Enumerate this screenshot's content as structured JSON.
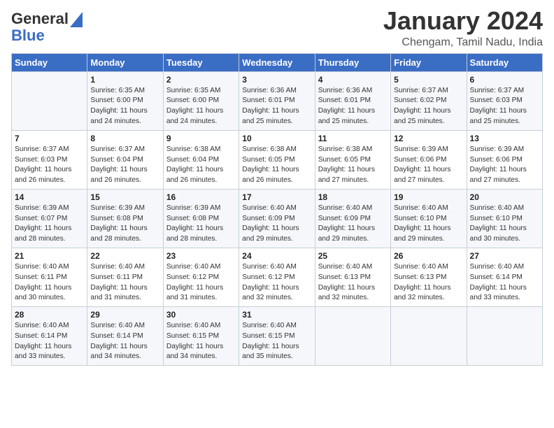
{
  "logo": {
    "line1": "General",
    "line2": "Blue"
  },
  "title": "January 2024",
  "location": "Chengam, Tamil Nadu, India",
  "days_of_week": [
    "Sunday",
    "Monday",
    "Tuesday",
    "Wednesday",
    "Thursday",
    "Friday",
    "Saturday"
  ],
  "weeks": [
    [
      {
        "day": "",
        "info": ""
      },
      {
        "day": "1",
        "info": "Sunrise: 6:35 AM\nSunset: 6:00 PM\nDaylight: 11 hours\nand 24 minutes."
      },
      {
        "day": "2",
        "info": "Sunrise: 6:35 AM\nSunset: 6:00 PM\nDaylight: 11 hours\nand 24 minutes."
      },
      {
        "day": "3",
        "info": "Sunrise: 6:36 AM\nSunset: 6:01 PM\nDaylight: 11 hours\nand 25 minutes."
      },
      {
        "day": "4",
        "info": "Sunrise: 6:36 AM\nSunset: 6:01 PM\nDaylight: 11 hours\nand 25 minutes."
      },
      {
        "day": "5",
        "info": "Sunrise: 6:37 AM\nSunset: 6:02 PM\nDaylight: 11 hours\nand 25 minutes."
      },
      {
        "day": "6",
        "info": "Sunrise: 6:37 AM\nSunset: 6:03 PM\nDaylight: 11 hours\nand 25 minutes."
      }
    ],
    [
      {
        "day": "7",
        "info": "Sunrise: 6:37 AM\nSunset: 6:03 PM\nDaylight: 11 hours\nand 26 minutes."
      },
      {
        "day": "8",
        "info": "Sunrise: 6:37 AM\nSunset: 6:04 PM\nDaylight: 11 hours\nand 26 minutes."
      },
      {
        "day": "9",
        "info": "Sunrise: 6:38 AM\nSunset: 6:04 PM\nDaylight: 11 hours\nand 26 minutes."
      },
      {
        "day": "10",
        "info": "Sunrise: 6:38 AM\nSunset: 6:05 PM\nDaylight: 11 hours\nand 26 minutes."
      },
      {
        "day": "11",
        "info": "Sunrise: 6:38 AM\nSunset: 6:05 PM\nDaylight: 11 hours\nand 27 minutes."
      },
      {
        "day": "12",
        "info": "Sunrise: 6:39 AM\nSunset: 6:06 PM\nDaylight: 11 hours\nand 27 minutes."
      },
      {
        "day": "13",
        "info": "Sunrise: 6:39 AM\nSunset: 6:06 PM\nDaylight: 11 hours\nand 27 minutes."
      }
    ],
    [
      {
        "day": "14",
        "info": "Sunrise: 6:39 AM\nSunset: 6:07 PM\nDaylight: 11 hours\nand 28 minutes."
      },
      {
        "day": "15",
        "info": "Sunrise: 6:39 AM\nSunset: 6:08 PM\nDaylight: 11 hours\nand 28 minutes."
      },
      {
        "day": "16",
        "info": "Sunrise: 6:39 AM\nSunset: 6:08 PM\nDaylight: 11 hours\nand 28 minutes."
      },
      {
        "day": "17",
        "info": "Sunrise: 6:40 AM\nSunset: 6:09 PM\nDaylight: 11 hours\nand 29 minutes."
      },
      {
        "day": "18",
        "info": "Sunrise: 6:40 AM\nSunset: 6:09 PM\nDaylight: 11 hours\nand 29 minutes."
      },
      {
        "day": "19",
        "info": "Sunrise: 6:40 AM\nSunset: 6:10 PM\nDaylight: 11 hours\nand 29 minutes."
      },
      {
        "day": "20",
        "info": "Sunrise: 6:40 AM\nSunset: 6:10 PM\nDaylight: 11 hours\nand 30 minutes."
      }
    ],
    [
      {
        "day": "21",
        "info": "Sunrise: 6:40 AM\nSunset: 6:11 PM\nDaylight: 11 hours\nand 30 minutes."
      },
      {
        "day": "22",
        "info": "Sunrise: 6:40 AM\nSunset: 6:11 PM\nDaylight: 11 hours\nand 31 minutes."
      },
      {
        "day": "23",
        "info": "Sunrise: 6:40 AM\nSunset: 6:12 PM\nDaylight: 11 hours\nand 31 minutes."
      },
      {
        "day": "24",
        "info": "Sunrise: 6:40 AM\nSunset: 6:12 PM\nDaylight: 11 hours\nand 32 minutes."
      },
      {
        "day": "25",
        "info": "Sunrise: 6:40 AM\nSunset: 6:13 PM\nDaylight: 11 hours\nand 32 minutes."
      },
      {
        "day": "26",
        "info": "Sunrise: 6:40 AM\nSunset: 6:13 PM\nDaylight: 11 hours\nand 32 minutes."
      },
      {
        "day": "27",
        "info": "Sunrise: 6:40 AM\nSunset: 6:14 PM\nDaylight: 11 hours\nand 33 minutes."
      }
    ],
    [
      {
        "day": "28",
        "info": "Sunrise: 6:40 AM\nSunset: 6:14 PM\nDaylight: 11 hours\nand 33 minutes."
      },
      {
        "day": "29",
        "info": "Sunrise: 6:40 AM\nSunset: 6:14 PM\nDaylight: 11 hours\nand 34 minutes."
      },
      {
        "day": "30",
        "info": "Sunrise: 6:40 AM\nSunset: 6:15 PM\nDaylight: 11 hours\nand 34 minutes."
      },
      {
        "day": "31",
        "info": "Sunrise: 6:40 AM\nSunset: 6:15 PM\nDaylight: 11 hours\nand 35 minutes."
      },
      {
        "day": "",
        "info": ""
      },
      {
        "day": "",
        "info": ""
      },
      {
        "day": "",
        "info": ""
      }
    ]
  ]
}
